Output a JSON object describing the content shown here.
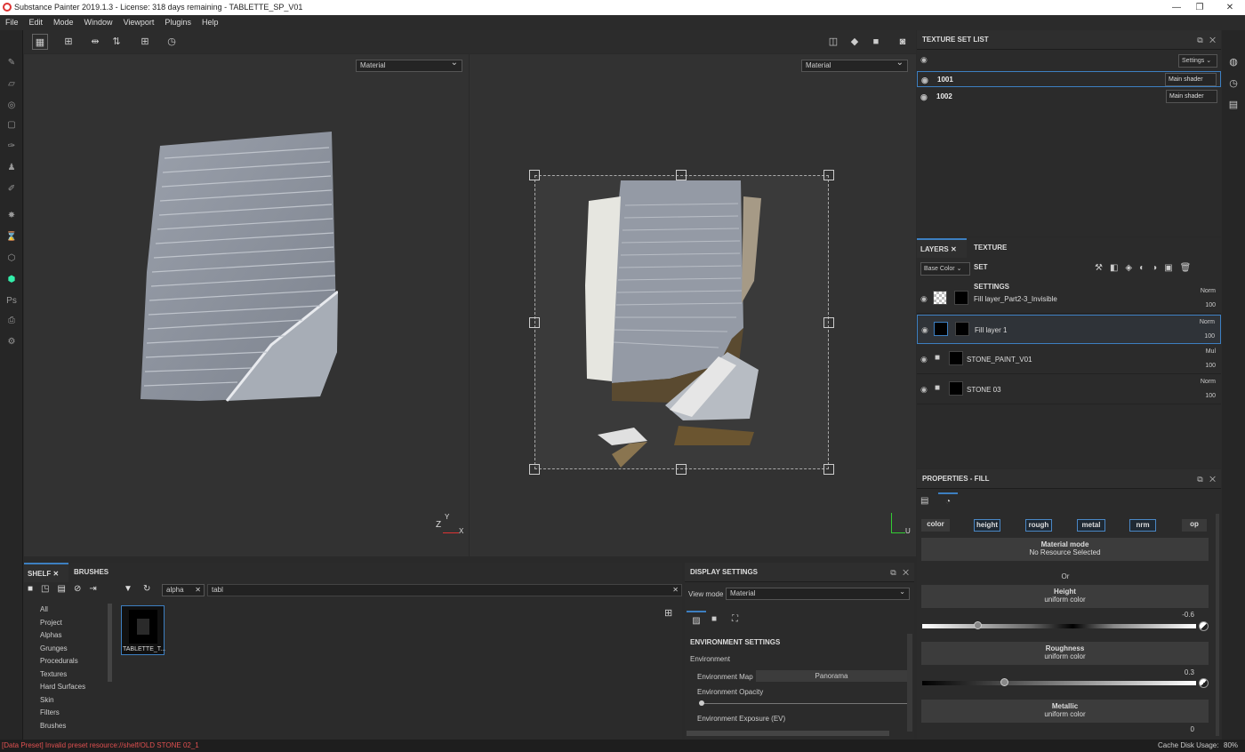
{
  "window": {
    "title": "Substance Painter 2019.1.3 - License: 318 days remaining - TABLETTE_SP_V01",
    "minimize": "—",
    "maximize": "❐",
    "close": "✕"
  },
  "menu": [
    "File",
    "Edit",
    "Mode",
    "Window",
    "Viewport",
    "Plugins",
    "Help"
  ],
  "viewport": {
    "left_mode": "Material",
    "right_mode": "Material",
    "axis_z": "Z",
    "axis_y": "Y",
    "axis_x": "X",
    "axis_u": "U"
  },
  "texture_set_list": {
    "title": "TEXTURE SET LIST",
    "settings_label": "Settings",
    "sets": [
      {
        "name": "1001",
        "shader": "Main shader"
      },
      {
        "name": "1002",
        "shader": "Main shader"
      }
    ]
  },
  "layers_panel": {
    "tab_layers": "LAYERS",
    "tab_tss": "TEXTURE SET SETTINGS",
    "channel": "Base Color",
    "layers": [
      {
        "name": "Fill layer_Part2-3_Invisible",
        "blend": "Norm",
        "opacity": "100"
      },
      {
        "name": "Fill layer 1",
        "blend": "Norm",
        "opacity": "100"
      },
      {
        "name": "STONE_PAINT_V01",
        "blend": "Mul",
        "opacity": "100"
      },
      {
        "name": "STONE 03",
        "blend": "Norm",
        "opacity": "100"
      }
    ]
  },
  "properties": {
    "title": "PROPERTIES - FILL",
    "channels": [
      "color",
      "height",
      "rough",
      "metal",
      "nrm",
      "op"
    ],
    "material_mode": "Material mode",
    "no_resource": "No Resource Selected",
    "or": "Or",
    "height_label": "Height",
    "height_sub": "uniform color",
    "height_value": "-0.6",
    "height_norm": 0.2,
    "rough_label": "Roughness",
    "rough_sub": "uniform color",
    "rough_value": "0.3",
    "rough_norm": 0.3,
    "metal_label": "Metallic",
    "metal_sub": "uniform color",
    "metal_value": "0"
  },
  "shelf": {
    "tab_shelf": "SHELF",
    "tab_brushes": "BRUSHES",
    "filter_tag": "alpha",
    "search_value": "tabl",
    "categories": [
      "All",
      "Project",
      "Alphas",
      "Grunges",
      "Procedurals",
      "Textures",
      "Hard Surfaces",
      "Skin",
      "Filters",
      "Brushes"
    ],
    "asset_name": "TABLETTE_T..."
  },
  "display_settings": {
    "title": "DISPLAY SETTINGS",
    "view_mode_label": "View mode",
    "view_mode_value": "Material",
    "env_settings": "ENVIRONMENT SETTINGS",
    "environment": "Environment",
    "env_map_label": "Environment Map",
    "env_map_value": "Panorama",
    "env_opacity": "Environment Opacity",
    "env_exposure": "Environment Exposure (EV)"
  },
  "status": {
    "error": "[Data Preset] Invalid preset resource://shelf/OLD STONE 02_1",
    "cache": "Cache Disk Usage:",
    "cache_value": "80%"
  }
}
